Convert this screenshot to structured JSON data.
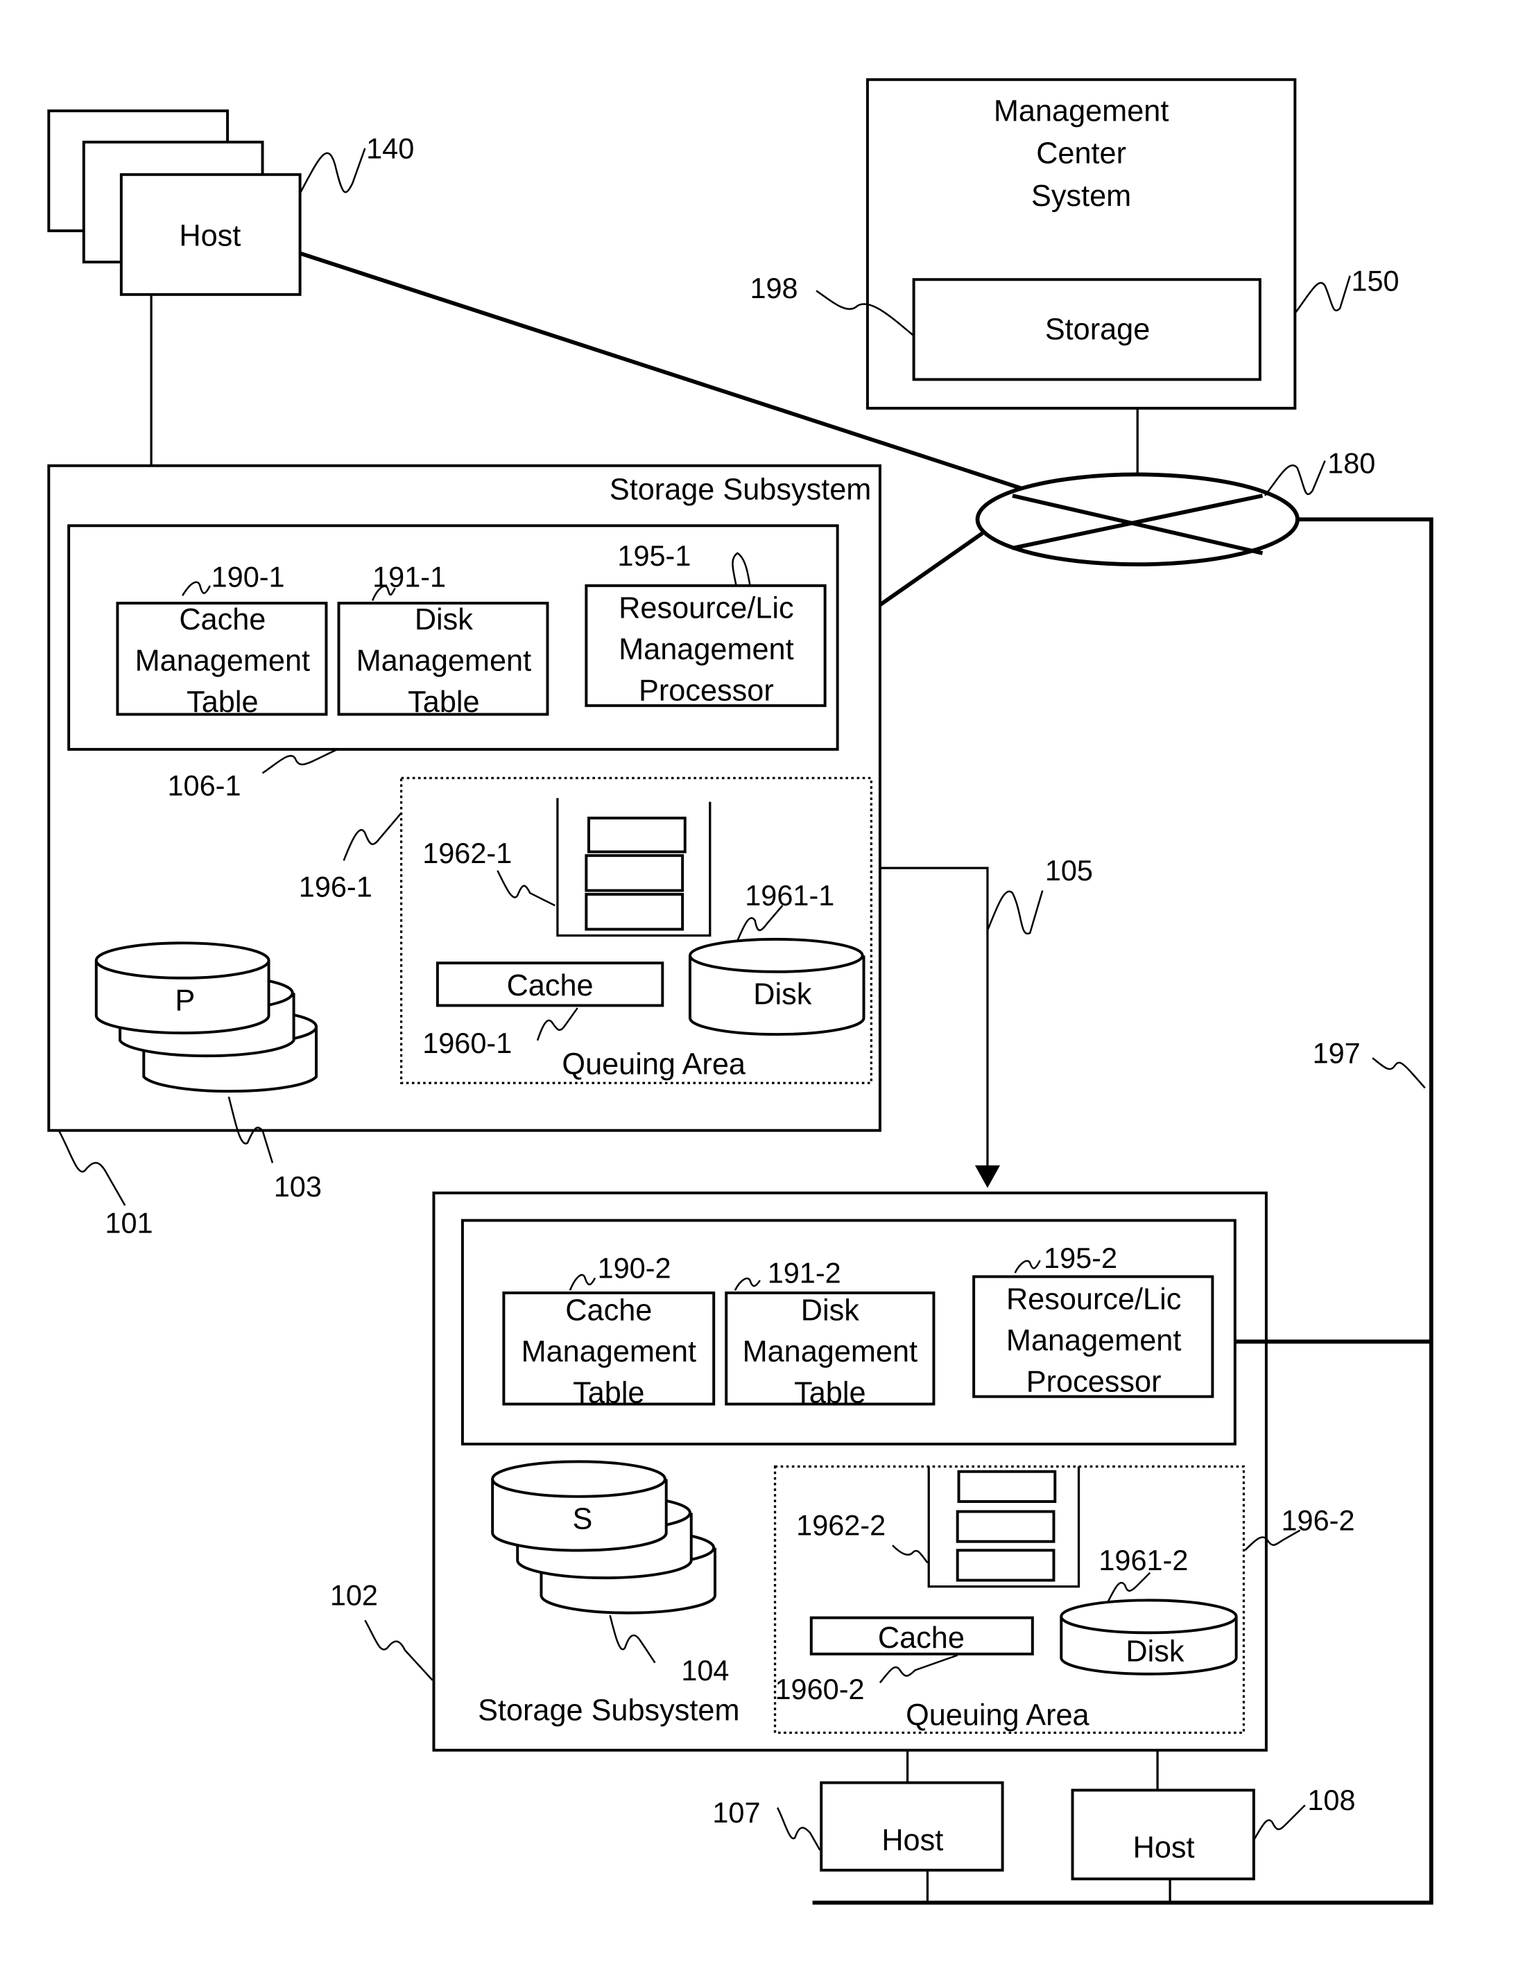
{
  "figure": {
    "host_top": {
      "label": "Host",
      "ref": "140"
    },
    "management_center": {
      "title_lines": [
        "Management",
        "Center",
        "System"
      ],
      "storage_label": "Storage",
      "ref": "150",
      "storage_ref": "198"
    },
    "network": {
      "ref": "180"
    },
    "subsystem_1": {
      "title": "Storage Subsystem",
      "ref": "101",
      "controller_ref": "106-1",
      "cache_table": {
        "lines": [
          "Cache",
          "Management",
          "Table"
        ],
        "ref": "190-1"
      },
      "disk_table": {
        "lines": [
          "Disk",
          "Management",
          "Table"
        ],
        "ref": "191-1"
      },
      "processor": {
        "lines": [
          "Resource/Lic",
          "Management",
          "Processor"
        ],
        "ref": "195-1"
      },
      "volume": {
        "label": "P",
        "ref": "103"
      },
      "queuing_area": {
        "label": "Queuing Area",
        "ref": "196-1",
        "queue_ref": "1962-1",
        "cache_label": "Cache",
        "cache_ref": "1960-1",
        "disk_label": "Disk",
        "disk_ref": "1961-1"
      }
    },
    "link_105": {
      "ref": "105"
    },
    "link_197": {
      "ref": "197"
    },
    "subsystem_2": {
      "title": "Storage Subsystem",
      "ref": "102",
      "cache_table": {
        "lines": [
          "Cache",
          "Management",
          "Table"
        ],
        "ref": "190-2"
      },
      "disk_table": {
        "lines": [
          "Disk",
          "Management",
          "Table"
        ],
        "ref": "191-2"
      },
      "processor": {
        "lines": [
          "Resource/Lic",
          "Management",
          "Processor"
        ],
        "ref": "195-2"
      },
      "volume": {
        "label": "S",
        "ref": "104"
      },
      "queuing_area": {
        "label": "Queuing Area",
        "ref": "196-2",
        "queue_ref": "1962-2",
        "cache_label": "Cache",
        "cache_ref": "1960-2",
        "disk_label": "Disk",
        "disk_ref": "1961-2"
      }
    },
    "host_107": {
      "label": "Host",
      "ref": "107"
    },
    "host_108": {
      "label": "Host",
      "ref": "108"
    }
  }
}
